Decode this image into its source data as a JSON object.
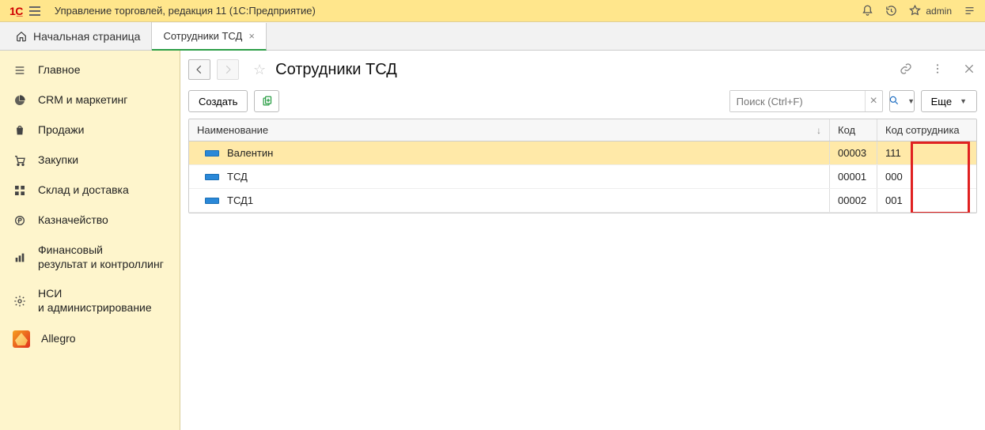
{
  "titlebar": {
    "app_title": "Управление торговлей, редакция 11  (1С:Предприятие)",
    "user": "admin"
  },
  "tabs": {
    "home": "Начальная страница",
    "active": {
      "label": "Сотрудники ТСД"
    }
  },
  "sidebar": {
    "items": [
      {
        "label": "Главное"
      },
      {
        "label": "CRM и маркетинг"
      },
      {
        "label": "Продажи"
      },
      {
        "label": "Закупки"
      },
      {
        "label": "Склад и доставка"
      },
      {
        "label": "Казначейство"
      },
      {
        "label": "Финансовый\nрезультат и контроллинг"
      },
      {
        "label": "НСИ\nи администрирование"
      },
      {
        "label": "Allegro"
      }
    ]
  },
  "main": {
    "title": "Сотрудники ТСД",
    "create_label": "Создать",
    "search_placeholder": "Поиск (Ctrl+F)",
    "more_label": "Еще"
  },
  "table": {
    "columns": {
      "name": "Наименование",
      "code": "Код",
      "emp_code": "Код сотрудника"
    },
    "rows": [
      {
        "name": "Валентин",
        "code": "00003",
        "emp_code": "111",
        "selected": true
      },
      {
        "name": "ТСД",
        "code": "00001",
        "emp_code": "000",
        "selected": false
      },
      {
        "name": "ТСД1",
        "code": "00002",
        "emp_code": "001",
        "selected": false
      }
    ]
  }
}
